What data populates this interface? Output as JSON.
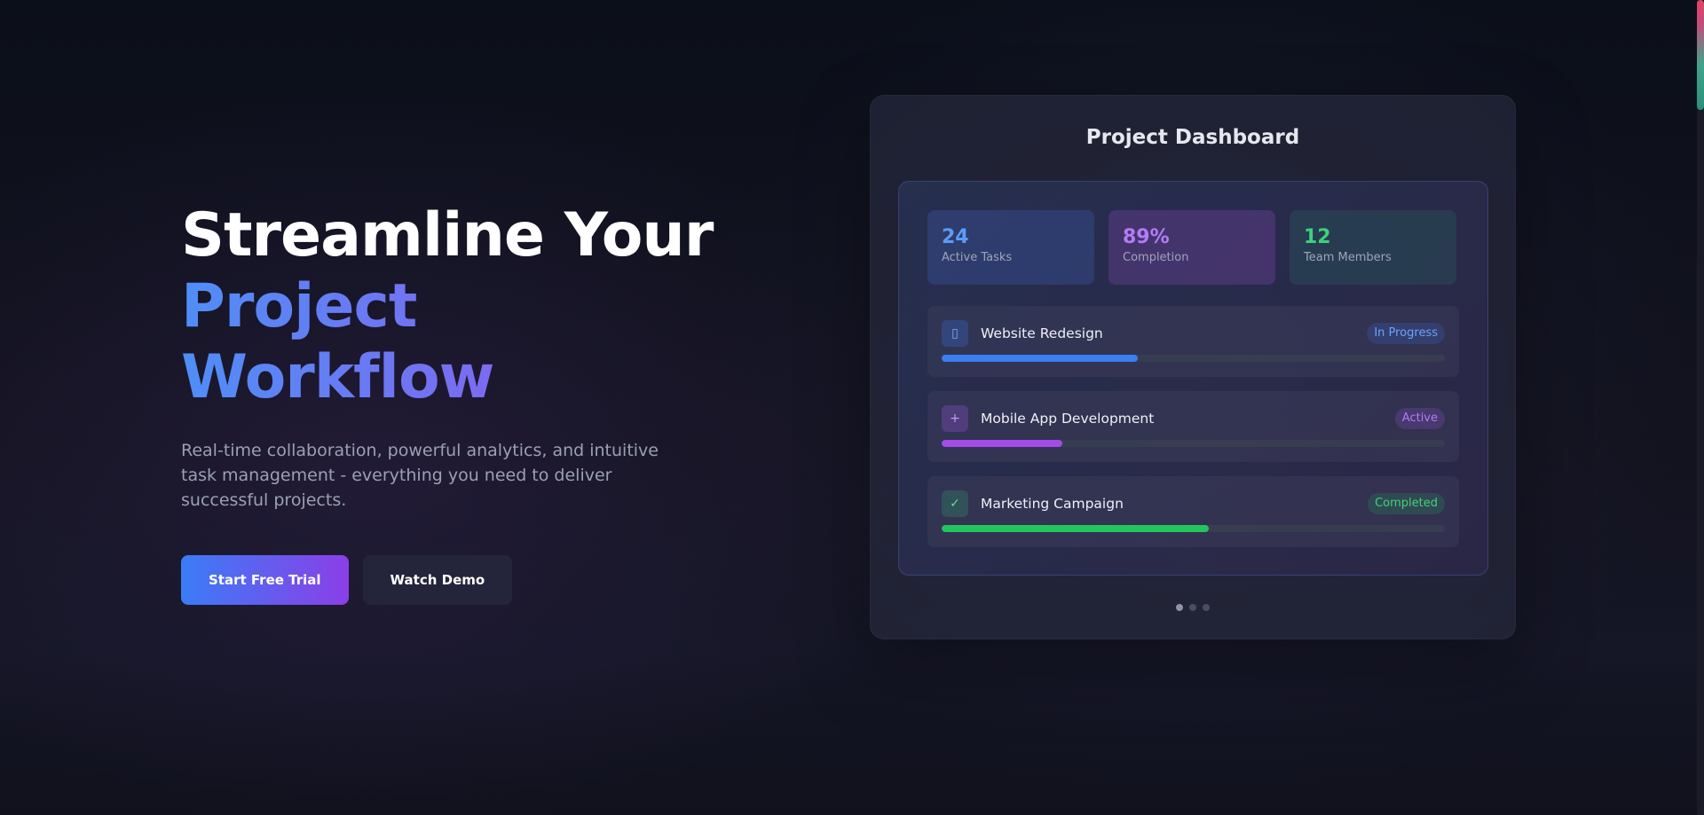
{
  "hero": {
    "headline_line1": "Streamline Your",
    "headline_line2": "Project Workflow",
    "subtitle": "Real-time collaboration, powerful analytics, and intuitive task management - everything you need to deliver successful projects.",
    "primary_cta": "Start Free Trial",
    "secondary_cta": "Watch Demo"
  },
  "dashboard": {
    "title": "Project Dashboard",
    "stats": [
      {
        "value": "24",
        "label": "Active Tasks",
        "color": "#5b9cf8"
      },
      {
        "value": "89%",
        "label": "Completion",
        "color": "#b37cf6"
      },
      {
        "value": "12",
        "label": "Team Members",
        "color": "#3ed17a"
      }
    ],
    "projects": [
      {
        "name": "Website Redesign",
        "status": "In Progress",
        "icon": "clipboard-icon",
        "glyph": "▯",
        "progress": 0.39,
        "color": "#3b7ff0"
      },
      {
        "name": "Mobile App Development",
        "status": "Active",
        "icon": "plus-icon",
        "glyph": "+",
        "progress": 0.24,
        "color": "#a44be8"
      },
      {
        "name": "Marketing Campaign",
        "status": "Completed",
        "icon": "check-icon",
        "glyph": "✓",
        "progress": 0.53,
        "color": "#22c55e"
      }
    ],
    "carousel": {
      "total": 3,
      "active_index": 0
    }
  },
  "colors": {
    "accent_blue": "#3b7cf6",
    "accent_purple": "#8b3fe6",
    "background": "#0b0f1a"
  }
}
